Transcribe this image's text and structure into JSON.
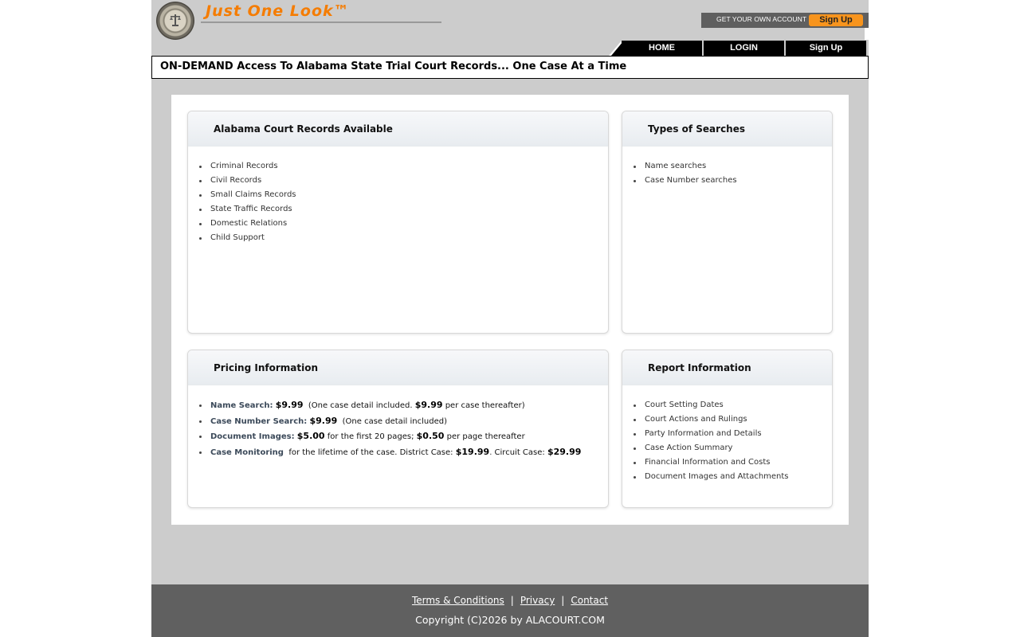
{
  "header": {
    "brand": "Just One Look™",
    "seal_icon": "court-seal-icon",
    "account_prompt": "GET YOUR OWN ACCOUNT",
    "signup_label": "Sign Up",
    "accent_color": "#f7941d"
  },
  "nav": {
    "items": [
      {
        "label": "HOME"
      },
      {
        "label": "LOGIN"
      },
      {
        "label": "Sign Up"
      }
    ]
  },
  "tagline": "ON-DEMAND Access To Alabama State Trial Court Records... One Case At a Time",
  "cards": {
    "records": {
      "title": "Alabama Court Records Available",
      "items": [
        "Criminal Records",
        "Civil Records",
        "Small Claims Records",
        "State Traffic Records",
        "Domestic Relations",
        "Child Support"
      ]
    },
    "types": {
      "title": "Types of Searches",
      "items": [
        "Name searches",
        "Case Number searches"
      ]
    },
    "pricing": {
      "title": "Pricing Information",
      "items": [
        {
          "label": "Name Search:",
          "price": "$9.99",
          "text1": "(One case detail included.",
          "price2": "$9.99",
          "text2": "per case thereafter)"
        },
        {
          "label": "Case Number Search:",
          "price": "$9.99",
          "text1": "(One case detail included)"
        },
        {
          "label": "Document Images:",
          "price": "$5.00",
          "text1": "for the first 20 pages;",
          "price2": "$0.50",
          "text2": "per page thereafter"
        },
        {
          "label": "Case Monitoring",
          "text1": "for the lifetime of the case. District Case:",
          "price": "$19.99",
          "text2": "Circuit Case:",
          "price2": "$29.99"
        }
      ]
    },
    "report": {
      "title": "Report Information",
      "items": [
        "Court Setting Dates",
        "Court Actions and Rulings",
        "Party Information and Details",
        "Case Action Summary",
        "Financial Information and Costs",
        "Document Images and Attachments"
      ]
    }
  },
  "footer": {
    "links": [
      "Terms & Conditions",
      "Privacy",
      "Contact"
    ],
    "separator": "|",
    "copyright": "Copyright (C)2026 by ALACOURT.COM"
  }
}
